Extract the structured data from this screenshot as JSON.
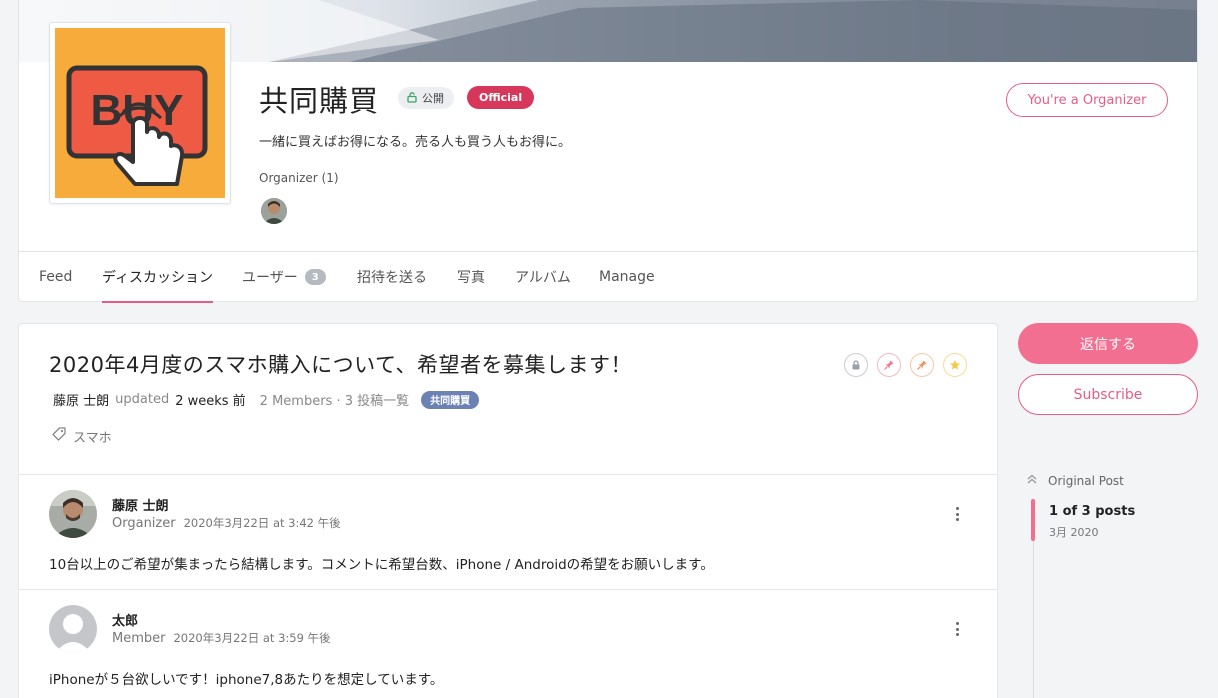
{
  "group": {
    "name": "共同購買",
    "logo_text": "BUY",
    "visibility_badge": "公開",
    "official_badge": "Official",
    "description": "一緒に買えばお得になる。売る人も買う人もお得に。",
    "organizer_label": "Organizer (1)",
    "organizer_button": "You're a Organizer"
  },
  "tabs": [
    {
      "label": "Feed"
    },
    {
      "label": "ディスカッション",
      "active": true
    },
    {
      "label": "ユーザー",
      "count": "3"
    },
    {
      "label": "招待を送る"
    },
    {
      "label": "写真"
    },
    {
      "label": "アルバム"
    },
    {
      "label": "Manage"
    }
  ],
  "discussion": {
    "title": "2020年4月度のスマホ購入について、希望者を募集します！",
    "author": "藤原 士朗",
    "updated_word": "updated",
    "updated_time": "2 weeks 前",
    "stats": "2 Members · 3 投稿一覧",
    "group_tag": "共同購買",
    "tag": "スマホ",
    "icons": [
      "lock-icon",
      "pin-icon",
      "pin-feature-icon",
      "star-icon"
    ]
  },
  "posts": [
    {
      "author": "藤原 士朗",
      "role": "Organizer",
      "date": "2020年3月22日 at 3:42 午後",
      "body": "10台以上のご希望が集まったら結構します。コメントに希望台数、iPhone / Androidの希望をお願いします。"
    },
    {
      "author": "太郎",
      "role": "Member",
      "date": "2020年3月22日 at 3:59 午後",
      "body": "iPhoneが５台欲しいです！iphone7,8あたりを想定しています。"
    }
  ],
  "sidebar": {
    "reply_button": "返信する",
    "subscribe_button": "Subscribe",
    "original_post": "Original Post",
    "post_count": "1 of 3 posts",
    "post_month": "3月 2020"
  },
  "colors": {
    "accent": "#e65d83",
    "official": "#d6375a",
    "tag": "#6c82b4",
    "logo_bg": "#f7ab3b",
    "logo_button": "#ee5a44"
  }
}
